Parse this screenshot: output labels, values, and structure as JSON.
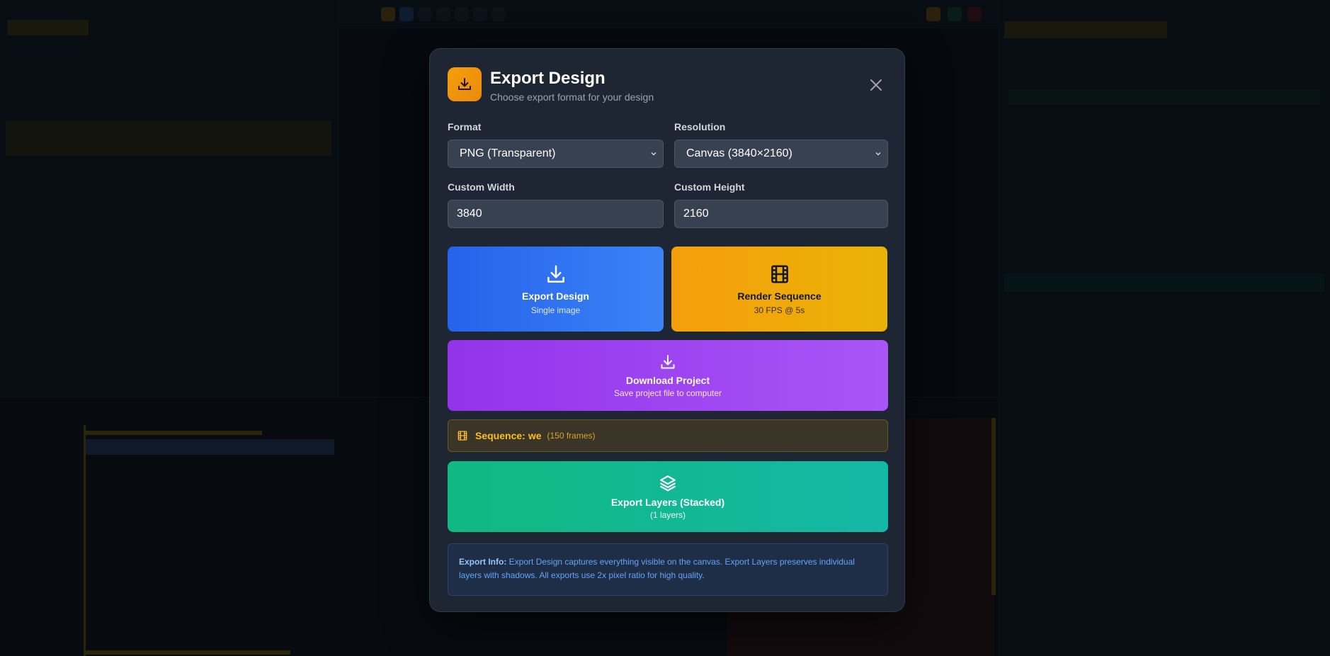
{
  "modal": {
    "title": "Export Design",
    "subtitle": "Choose export format for your design",
    "format": {
      "label": "Format",
      "value": "PNG (Transparent)"
    },
    "resolution": {
      "label": "Resolution",
      "value": "Canvas (3840×2160)"
    },
    "custom_width": {
      "label": "Custom Width",
      "value": "3840"
    },
    "custom_height": {
      "label": "Custom Height",
      "value": "2160"
    },
    "export_design": {
      "title": "Export Design",
      "subtitle": "Single image"
    },
    "render_sequence": {
      "title": "Render Sequence",
      "subtitle": "30 FPS @ 5s"
    },
    "download_project": {
      "title": "Download Project",
      "subtitle": "Save project file to computer"
    },
    "sequence": {
      "label": "Sequence:",
      "name": "we",
      "frames": "(150 frames)"
    },
    "export_layers": {
      "title": "Export Layers (Stacked)",
      "subtitle": "(1 layers)"
    },
    "info": {
      "label": "Export Info:",
      "text": "Export Design captures everything visible on the canvas. Export Layers preserves individual layers with shadows. All exports use 2x pixel ratio for high quality."
    }
  },
  "colors": {
    "accent_amber": "#f59e0b",
    "accent_blue": "#3b82f6",
    "accent_purple": "#a855f7",
    "accent_green": "#10b981",
    "modal_bg": "#1e2633"
  },
  "icons": {
    "header": "download-icon",
    "close": "close-icon",
    "export_design": "download-icon",
    "render_sequence": "film-icon",
    "download_project": "download-icon",
    "sequence": "film-icon",
    "export_layers": "layers-icon"
  }
}
